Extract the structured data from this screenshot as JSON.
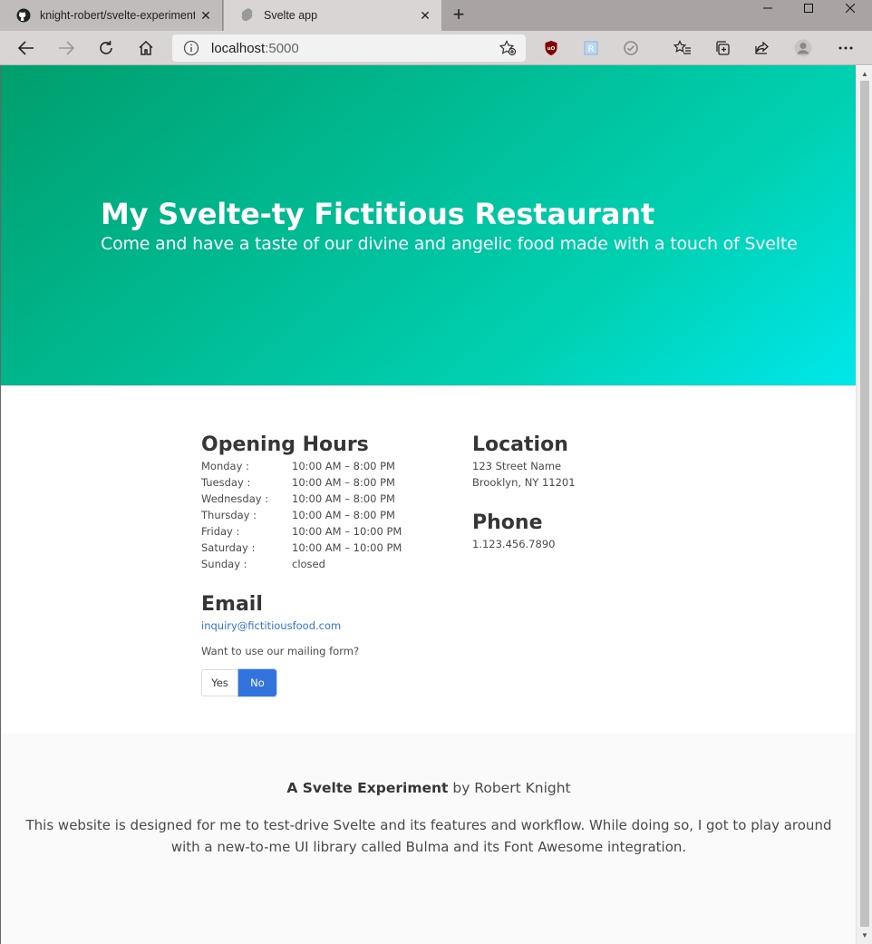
{
  "browser": {
    "tabs": [
      {
        "title": "knight-robert/svelte-experiment",
        "icon": "github-icon",
        "active": false
      },
      {
        "title": "Svelte app",
        "icon": "svelte-icon",
        "active": true
      }
    ],
    "address_host": "localhost",
    "address_port": ":5000",
    "colors": {
      "tabstrip": "#a9a4a3",
      "toolbar": "#d8d5d4"
    }
  },
  "hero": {
    "title": "My Svelte-ty Fictitious Restaurant",
    "subtitle": "Come and have a taste of our divine and angelic food made with a touch of Svelte",
    "gradient": [
      "#009e6c",
      "#00d1b2",
      "#00e7eb"
    ]
  },
  "hours": {
    "heading": "Opening Hours",
    "rows": [
      {
        "day": "Monday :",
        "time": "10:00 AM – 8:00 PM"
      },
      {
        "day": "Tuesday :",
        "time": "10:00 AM – 8:00 PM"
      },
      {
        "day": "Wednesday :",
        "time": "10:00 AM – 8:00 PM"
      },
      {
        "day": "Thursday :",
        "time": "10:00 AM – 8:00 PM"
      },
      {
        "day": "Friday :",
        "time": "10:00 AM – 10:00 PM"
      },
      {
        "day": "Saturday :",
        "time": "10:00 AM – 10:00 PM"
      },
      {
        "day": "Sunday :",
        "time": "closed"
      }
    ]
  },
  "location": {
    "heading": "Location",
    "line1": "123 Street Name",
    "line2": "Brooklyn, NY 11201"
  },
  "phone": {
    "heading": "Phone",
    "number": "1.123.456.7890"
  },
  "email": {
    "heading": "Email",
    "address": "inquiry@fictitiousfood.com",
    "question": "Want to use our mailing form?",
    "yes_label": "Yes",
    "no_label": "No",
    "selected": "No",
    "accent": "#3273dc"
  },
  "footer": {
    "strong": "A Svelte Experiment",
    "by": " by Robert Knight",
    "description": "This website is designed for me to test-drive Svelte and its features and workflow. While doing so, I got to play around with a new-to-me UI library called Bulma and its Font Awesome integration."
  }
}
